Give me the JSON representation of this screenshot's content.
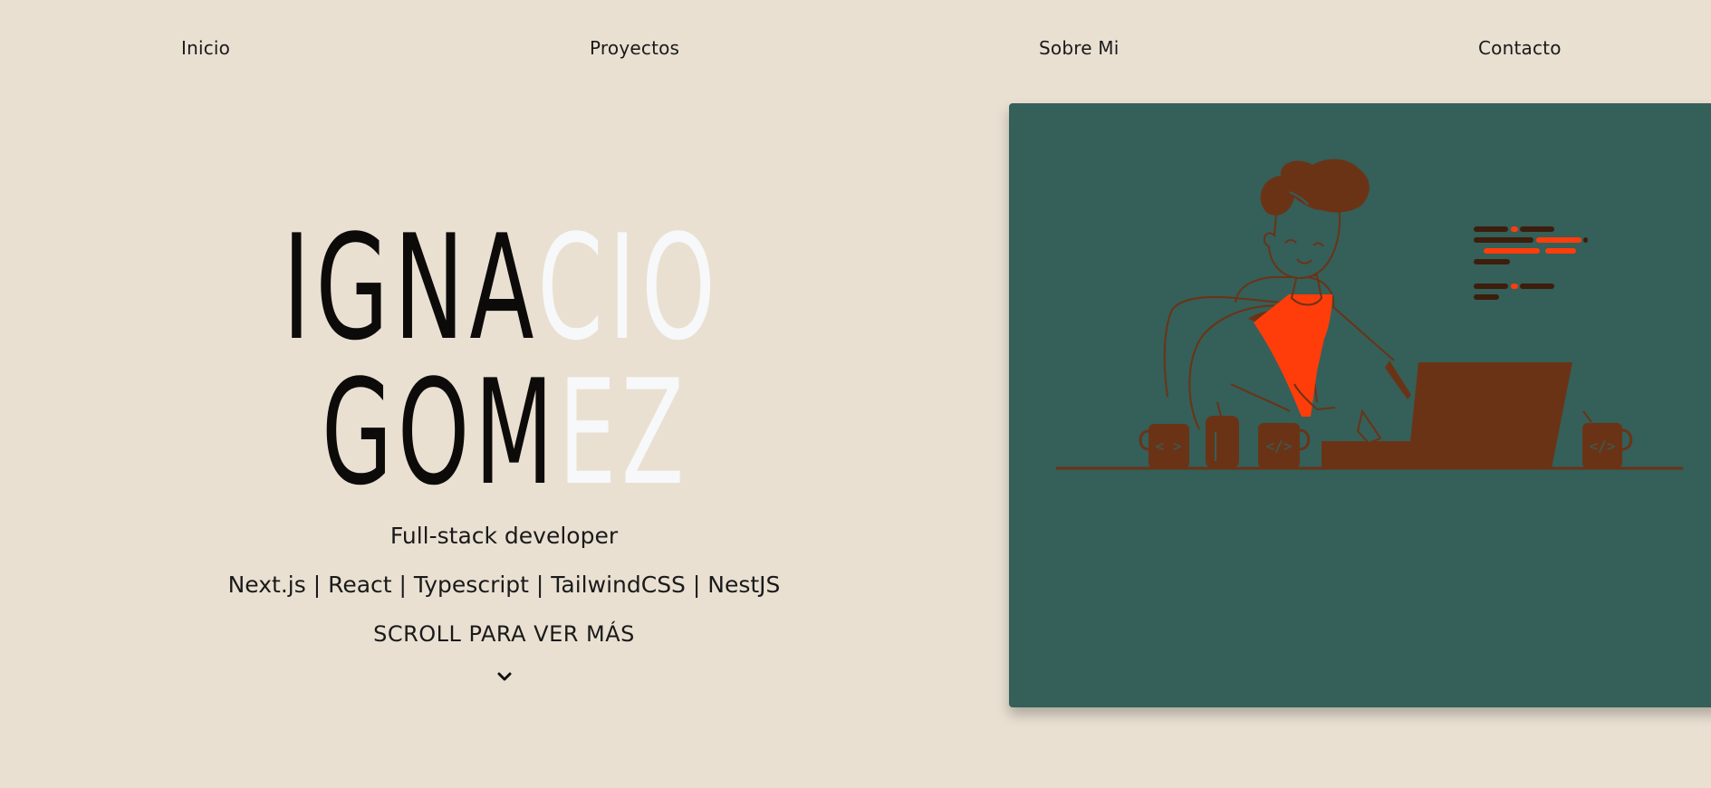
{
  "nav": {
    "items": [
      {
        "label": "Inicio"
      },
      {
        "label": "Proyectos"
      },
      {
        "label": "Sobre Mi"
      },
      {
        "label": "Contacto"
      }
    ]
  },
  "hero": {
    "name_line1_dark": "IGNA",
    "name_line1_light": "CIO",
    "name_line2_dark": "GOM",
    "name_line2_light": "EZ",
    "subtitle": "Full-stack developer",
    "stack": "Next.js | React | Typescript | TailwindCSS | NestJS",
    "scroll_cta": "SCROLL PARA VER MÁS",
    "scroll_icon": "chevron-down-icon"
  },
  "illustration": {
    "subject": "developer-at-laptop-illustration",
    "colors": {
      "card_background": "#355f59",
      "brown": "#6b3316",
      "orange": "#ff3d0a",
      "dark_brown": "#3d1d0c"
    }
  },
  "colors": {
    "page_background": "#e9e0d2",
    "name_dark": "#0d0b0a",
    "name_light": "#f7f8f9"
  }
}
